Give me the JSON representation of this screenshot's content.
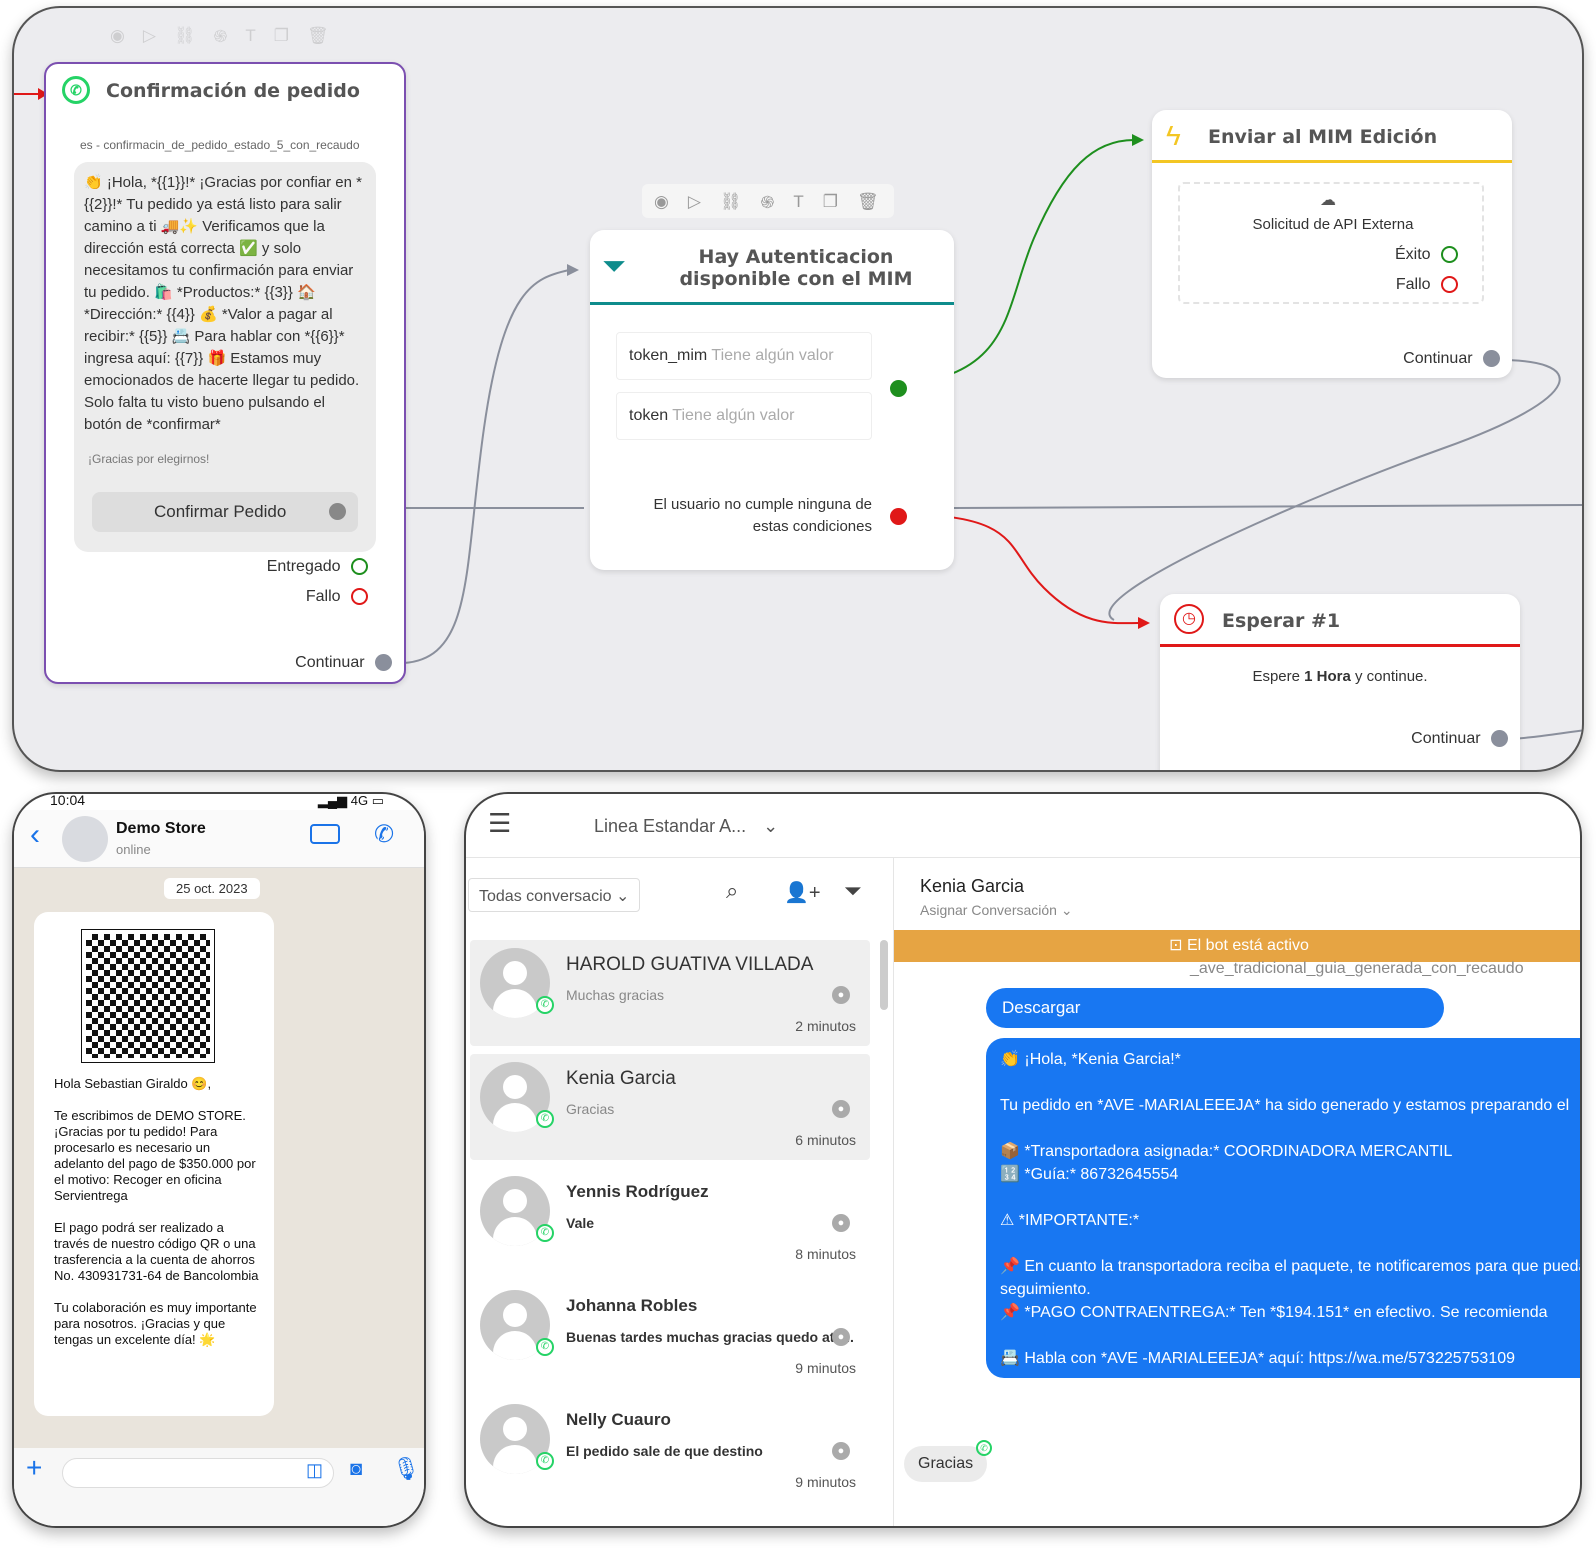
{
  "flow": {
    "toolbar_icons": [
      "eye-icon",
      "play-icon",
      "link-icon",
      "fingerprint-icon",
      "text-icon",
      "copy-icon",
      "trash-icon"
    ],
    "confirm": {
      "title": "Confirmación de pedido",
      "template": "es - confirmacin_de_pedido_estado_5_con_recaudo",
      "body": "👏 ¡Hola, *{{1}}!* ¡Gracias por confiar en *{{2}}!* Tu pedido ya está listo para salir camino a ti 🚚✨ Verificamos que la dirección está correcta ✅ y solo necesitamos tu confirmación para enviar tu pedido. 🛍️ *Productos:* {{3}} 🏠 *Dirección:* {{4}} 💰 *Valor a pagar al recibir:* {{5}} 📇 Para hablar con *{{6}}* ingresa aquí: {{7}} 🎁 Estamos muy emocionados de hacerte llegar tu pedido. Solo falta tu visto bueno pulsando el botón de *confirmar*",
      "footer": "¡Gracias por elegirnos!",
      "button": "Confirmar Pedido",
      "delivered": "Entregado",
      "fail": "Fallo",
      "continue": "Continuar"
    },
    "condition": {
      "title": "Hay Autenticacion disponible con el MIM",
      "rule1_key": "token_mim",
      "rule1_val": "Tiene algún valor",
      "rule2_key": "token",
      "rule2_val": "Tiene algún valor",
      "else": "El usuario no cumple ninguna de estas condiciones"
    },
    "mim": {
      "title": "Enviar al MIM Edición",
      "api": "Solicitud de API Externa",
      "success": "Éxito",
      "fail": "Fallo",
      "continue": "Continuar"
    },
    "wait": {
      "title": "Esperar #1",
      "text_pre": "Espere ",
      "text_bold": "1 Hora",
      "text_post": " y continue.",
      "continue": "Continuar"
    },
    "colors": {
      "green": "#1e8f1e",
      "red": "#e01818",
      "purple": "#7b4fb0",
      "teal": "#0e8c8c",
      "yellow": "#f3c623"
    }
  },
  "phone": {
    "time": "10:04",
    "signal": "4G",
    "contact": "Demo Store",
    "status": "online",
    "date": "25 oct. 2023",
    "message": [
      "Hola Sebastian Giraldo 😊,",
      "",
      "Te escribimos de DEMO STORE. ¡Gracias por tu pedido! Para procesarlo es necesario un adelanto del pago de $350.000 por el motivo: Recoger en oficina Servientrega",
      "",
      "El pago podrá ser realizado a través de nuestro código QR o una trasferencia a la cuenta de ahorros No. 430931731-64 de Bancolombia",
      "",
      "Tu colaboración es muy importante para nosotros. ¡Gracias y que tengas un excelente día! 🌟"
    ]
  },
  "crm": {
    "line": "Linea Estandar A...",
    "filter": "Todas conversacio",
    "conversations": [
      {
        "name": "HAROLD GUATIVA VILLADA",
        "msg": "Muchas gracias",
        "time": "2 minutos",
        "bold": false
      },
      {
        "name": "Kenia Garcia",
        "msg": "Gracias",
        "time": "6 minutos",
        "bold": false
      },
      {
        "name": "Yennis Rodríguez",
        "msg": "Vale",
        "time": "8 minutos",
        "bold": true
      },
      {
        "name": "Johanna Robles",
        "msg": "Buenas tardes muchas gracias quedo ate...",
        "time": "9 minutos",
        "bold": true
      },
      {
        "name": "Nelly Cuauro",
        "msg": "El pedido sale de que destino",
        "time": "9 minutos",
        "bold": true
      }
    ],
    "chat": {
      "name": "Kenia Garcia",
      "assign": "Asignar Conversación",
      "bot": "El bot está activo",
      "template": "_ave_tradicional_guia_generada_con_recaudo",
      "download": "Descargar",
      "lines": [
        "👏 ¡Hola, *Kenia Garcia!*",
        "",
        "Tu pedido en *AVE -MARIALEEEJA* ha sido generado y estamos preparando el",
        "",
        "📦 *Transportadora asignada:* COORDINADORA MERCANTIL",
        "🔢 *Guía:* 86732645554",
        "",
        "⚠ *IMPORTANTE:*",
        "",
        "📌 En cuanto la transportadora reciba el paquete, te notificaremos para que puedas hacer",
        "seguimiento.",
        "📌 *PAGO CONTRAENTREGA:* Ten *$194.151* en efectivo. Se recomienda",
        "",
        "📇 Habla con *AVE -MARIALEEEJA* aquí: https://wa.me/573225753109"
      ],
      "reply": "Gracias"
    }
  }
}
